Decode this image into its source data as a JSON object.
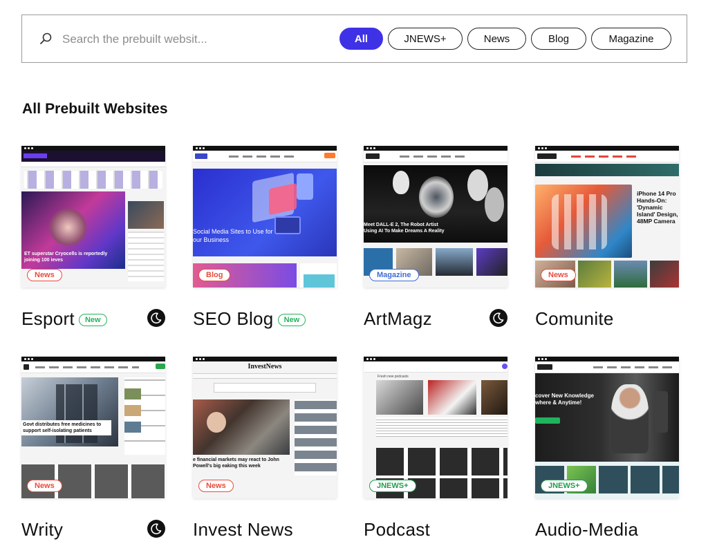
{
  "search": {
    "placeholder": "Search the prebuilt websit..."
  },
  "filters": [
    {
      "label": "All",
      "active": true
    },
    {
      "label": "JNEWS+",
      "active": false
    },
    {
      "label": "News",
      "active": false
    },
    {
      "label": "Blog",
      "active": false
    },
    {
      "label": "Magazine",
      "active": false
    }
  ],
  "heading": {
    "prefix": "All",
    "strong": "Prebuilt",
    "suffix": "Websites"
  },
  "cards": [
    {
      "name": "Esport",
      "badge": "News",
      "new_tag": "New",
      "dark_mode_icon": "moon-icon",
      "preview_headline": "ET superstar Cryocells is reportedly joining 100 ieves"
    },
    {
      "name": "SEO Blog",
      "badge": "Blog",
      "new_tag": "New",
      "preview_headline": "Social Media Sites to Use for our Business"
    },
    {
      "name": "ArtMagz",
      "badge": "Magazine",
      "dark_mode_icon": "moon-icon",
      "preview_headline": "Meet DALL-E 2, The Robot Artist Using AI To Make Dreams A Reality"
    },
    {
      "name": "Comunite",
      "badge": "News",
      "preview_headline": "iPhone 14 Pro Hands-On: 'Dynamic Island' Design, 48MP Camera"
    },
    {
      "name": "Writy",
      "badge": "News",
      "dark_mode_icon": "moon-icon",
      "preview_headline": "Govt distributes free medicines to support self-isolating patients"
    },
    {
      "name": "Invest News",
      "badge": "News",
      "preview_logo": "InvestNews",
      "preview_headline": "e financial markets may react to John Powell's big eaking this week"
    },
    {
      "name": "Podcast",
      "badge": "JNEWS+",
      "preview_headline": "Fresh new podcasts"
    },
    {
      "name": "Audio-Media",
      "badge": "JNEWS+",
      "preview_headline": "cover New Knowledge where & Anytime!"
    }
  ]
}
